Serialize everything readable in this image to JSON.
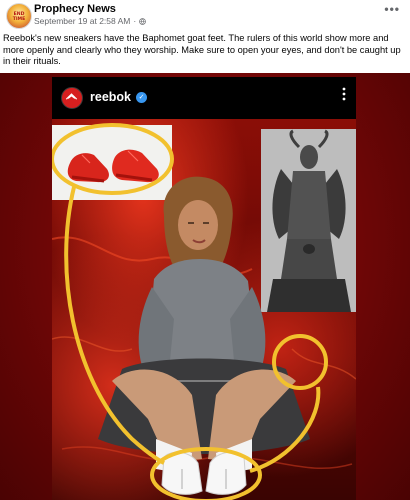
{
  "post": {
    "page_name": "Prophecy News",
    "avatar_text": "END TIME",
    "timestamp": "September 19 at 2:58 AM",
    "separator": "·",
    "more_label": "•••",
    "body": "Reebok's new sneakers have the Baphomet goat feet. The rulers of this world show more and more openly and clearly who they worship. Make sure to open your eyes, and don't be caught up in their rituals."
  },
  "instagram": {
    "handle": "reebok",
    "verified_glyph": "✓",
    "more_label": "⋮",
    "avatar_glyph": "Reebok"
  },
  "colors": {
    "highlight_circle": "#f2c12e",
    "background_red": "#8b0e07",
    "verified_blue": "#3897f0"
  },
  "icons": {
    "audience": "globe-icon",
    "options": "more-options-icon",
    "verified": "verified-badge-icon"
  }
}
